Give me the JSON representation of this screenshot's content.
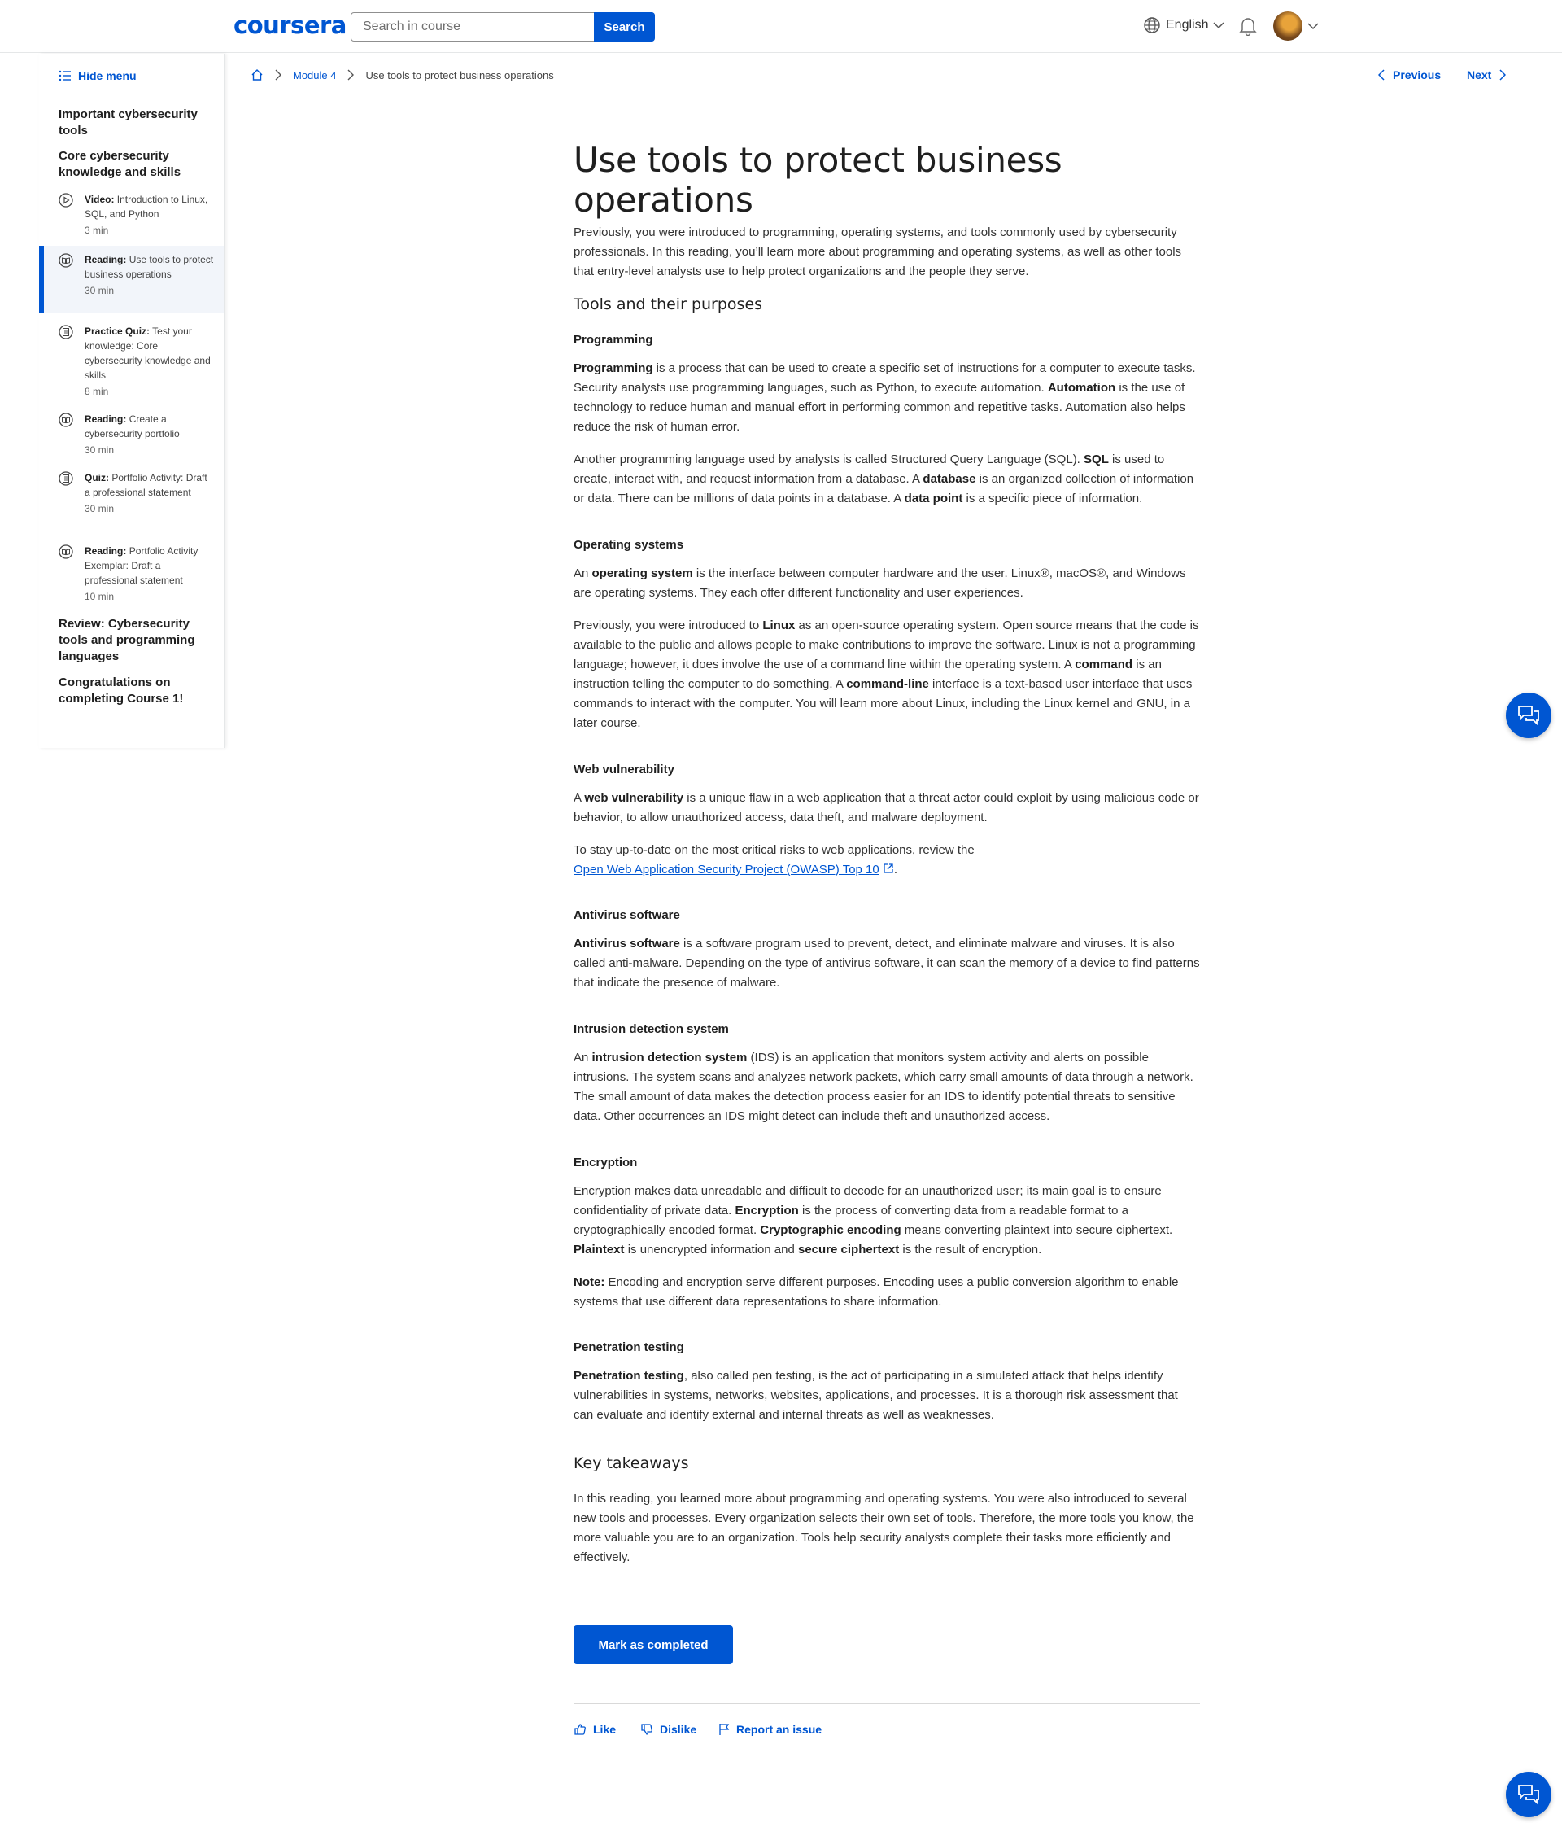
{
  "header": {
    "logo": "coursera",
    "search_placeholder": "Search in course",
    "search_button": "Search",
    "language": "English"
  },
  "sidebar": {
    "hide_menu": "Hide menu",
    "sections": [
      "Important cybersecurity tools",
      "Core cybersecurity knowledge and skills",
      "Review: Cybersecurity tools and programming languages",
      "Congratulations on completing Course 1!"
    ],
    "items": [
      {
        "type": "Video:",
        "title": "Introduction to Linux, SQL, and Python",
        "duration": "3 min",
        "icon": "play-icon"
      },
      {
        "type": "Reading:",
        "title": "Use tools to protect business operations",
        "duration": "30 min",
        "icon": "reading-icon"
      },
      {
        "type": "Practice Quiz:",
        "title": "Test your knowledge: Core cybersecurity knowledge and skills",
        "duration": "8 min",
        "icon": "quiz-icon"
      },
      {
        "type": "Reading:",
        "title": "Create a cybersecurity portfolio",
        "duration": "30 min",
        "icon": "reading-icon"
      },
      {
        "type": "Quiz:",
        "title": "Portfolio Activity: Draft a professional statement",
        "duration": "30 min",
        "icon": "quiz-icon"
      },
      {
        "type": "Reading:",
        "title": "Portfolio Activity Exemplar: Draft a professional statement",
        "duration": "10 min",
        "icon": "reading-icon"
      }
    ]
  },
  "breadcrumb": {
    "module": "Module 4",
    "current": "Use tools to protect business operations"
  },
  "nav": {
    "previous": "Previous",
    "next": "Next"
  },
  "article": {
    "title": "Use tools to protect business operations",
    "intro": "Previously, you were introduced to programming, operating systems, and tools commonly used by cybersecurity professionals. In this reading, you’ll learn more about programming and operating systems, as well as other tools that entry-level analysts use to help protect organizations and the people they serve.",
    "h_tools": "Tools and their purposes",
    "h_programming": "Programming",
    "h_os": "Operating systems",
    "h_web": "Web vulnerability",
    "h_antivirus": "Antivirus software",
    "h_ids": "Intrusion detection system",
    "h_encryption": "Encryption",
    "h_pentest": "Penetration testing",
    "h_takeaways": "Key takeaways",
    "owasp_link": "Open Web Application Security Project (OWASP) Top 10",
    "takeaways": "In this reading, you learned more about programming and operating systems. You were also introduced to several new tools and processes. Every organization selects their own set of tools. Therefore, the more tools you know, the more valuable you are to an organization. Tools help security analysts complete their tasks more efficiently and effectively."
  },
  "actions": {
    "mark_completed": "Mark as completed",
    "like": "Like",
    "dislike": "Dislike",
    "report": "Report an issue"
  },
  "colors": {
    "brand": "#0056d2",
    "text": "#1f1f1f",
    "active_bg": "#f2f5fa"
  }
}
